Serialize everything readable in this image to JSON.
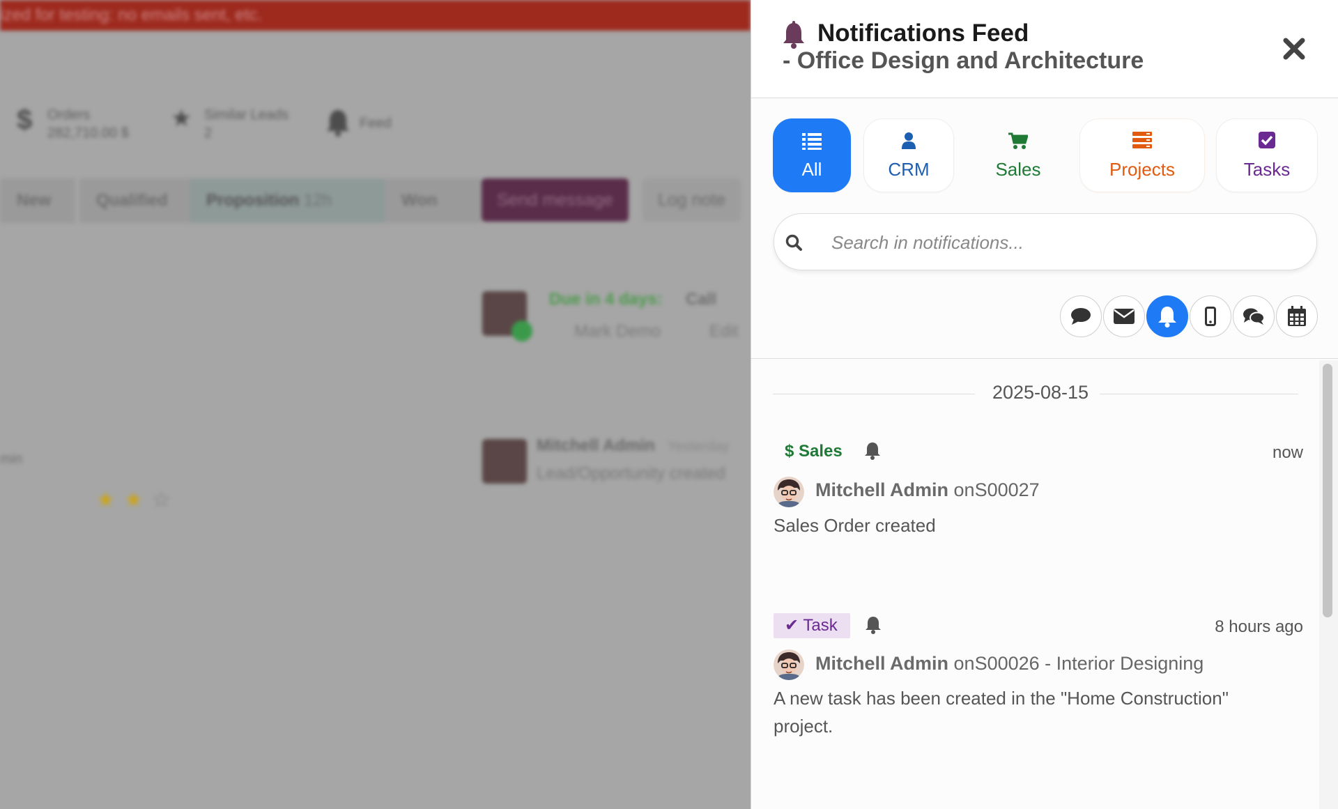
{
  "background": {
    "banner_text": "ized for testing: no emails sent, etc.",
    "stats": [
      {
        "icon": "dollar-icon",
        "label": "Orders",
        "value": "282,710.00 $"
      },
      {
        "icon": "star-icon",
        "label": "Similar Leads",
        "value": "2"
      },
      {
        "icon": "bell-icon",
        "label": "Feed",
        "value": ""
      }
    ],
    "stages": [
      "New",
      "Qualified",
      "Proposition",
      "Won"
    ],
    "active_stage_extra": "12h",
    "send_message_label": "Send message",
    "log_note_label": "Log note",
    "activity": {
      "due": "Due in 4 days:",
      "type": "Call",
      "user": "Mark Demo",
      "edit": "Edit"
    },
    "message": {
      "author": "Mitchell Admin",
      "time": "Yesterday",
      "text": "Lead/Opportunity created"
    },
    "left_text": "min",
    "rating": {
      "filled": 2,
      "total": 3
    }
  },
  "panel": {
    "title": "Notifications Feed",
    "subtitle": "- Office Design and Architecture",
    "tabs": [
      {
        "label": "All",
        "icon": "list-icon",
        "color": "#ffffff",
        "active": true
      },
      {
        "label": "CRM",
        "icon": "user-icon",
        "color": "#1c5fb0",
        "active": false
      },
      {
        "label": "Sales",
        "icon": "cart-icon",
        "color": "#1e7a35",
        "active": false
      },
      {
        "label": "Projects",
        "icon": "server-icon",
        "color": "#e05a10",
        "active": false
      },
      {
        "label": "Tasks",
        "icon": "checkbox-icon",
        "color": "#6b2a91",
        "active": false
      }
    ],
    "search": {
      "placeholder": "Search in notifications..."
    },
    "filters": [
      {
        "icon": "comment-icon",
        "active": false
      },
      {
        "icon": "envelope-icon",
        "active": false
      },
      {
        "icon": "bell-icon",
        "active": true
      },
      {
        "icon": "mobile-icon",
        "active": false
      },
      {
        "icon": "comments-icon",
        "active": false
      },
      {
        "icon": "calendar-icon",
        "active": false
      }
    ],
    "date_group": "2025-08-15",
    "notifications": [
      {
        "badge": "Sales",
        "badge_symbol": "$",
        "time": "now",
        "author": "Mitchell Admin",
        "ref": "onS00027",
        "body": "Sales Order created"
      },
      {
        "badge": "Task",
        "badge_symbol": "✔",
        "time": "8 hours ago",
        "author": "Mitchell Admin",
        "ref": "onS00026 - Interior Designing",
        "body": "A new task has been created in the \"Home Construction\" project."
      }
    ]
  }
}
